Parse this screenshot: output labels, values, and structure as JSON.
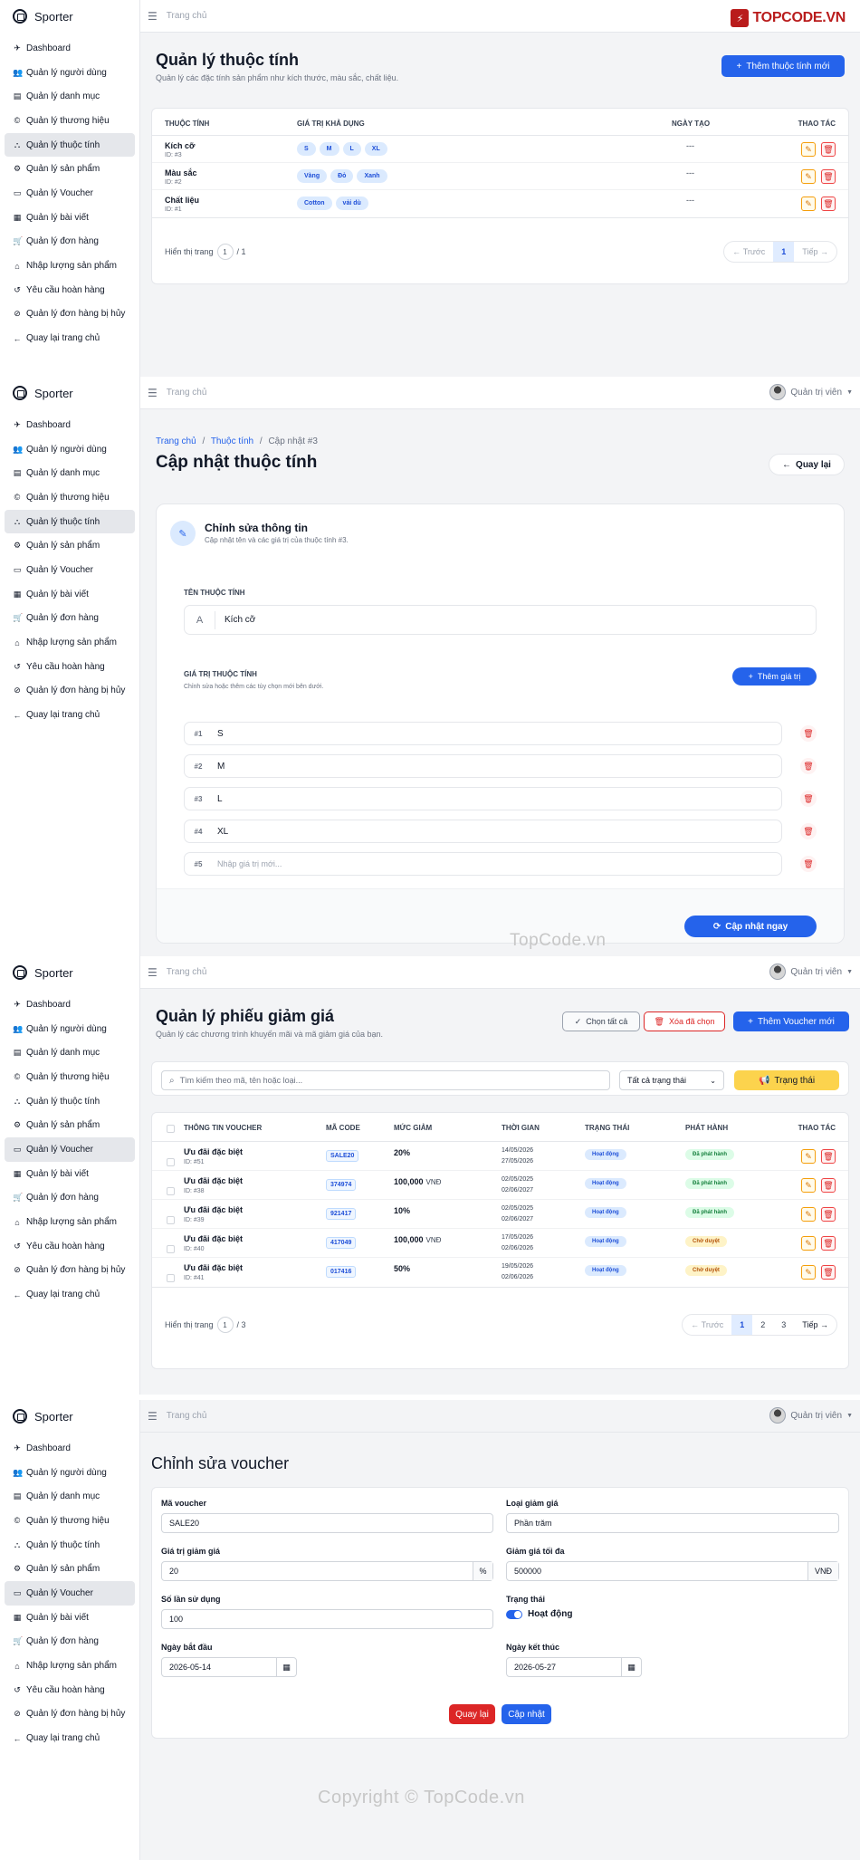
{
  "brand": "Sporter",
  "nav": [
    {
      "icon": "rocket-icon",
      "glyph": "✈",
      "label": "Dashboard"
    },
    {
      "icon": "users-icon",
      "glyph": "👥",
      "label": "Quản lý người dùng"
    },
    {
      "icon": "list-icon",
      "glyph": "▤",
      "label": "Quản lý danh mục"
    },
    {
      "icon": "copyright-icon",
      "glyph": "©",
      "label": "Quản lý thương hiệu"
    },
    {
      "icon": "sitemap-icon",
      "glyph": "⛬",
      "label": "Quản lý thuộc tính"
    },
    {
      "icon": "product-icon",
      "glyph": "⚙",
      "label": "Quản lý sản phẩm"
    },
    {
      "icon": "ticket-icon",
      "glyph": "▭",
      "label": "Quản lý Voucher"
    },
    {
      "icon": "newspaper-icon",
      "glyph": "▦",
      "label": "Quản lý bài viết"
    },
    {
      "icon": "cart-icon",
      "glyph": "🛒",
      "label": "Quản lý đơn hàng"
    },
    {
      "icon": "warehouse-icon",
      "glyph": "⌂",
      "label": "Nhập lượng sản phẩm"
    },
    {
      "icon": "undo-icon",
      "glyph": "↺",
      "label": "Yêu cầu hoàn hàng"
    },
    {
      "icon": "ban-icon",
      "glyph": "⊘",
      "label": "Quản lý đơn hàng bị hủy"
    },
    {
      "icon": "arrow-left-icon",
      "glyph": "←",
      "label": "Quay lại trang chủ"
    }
  ],
  "topbar": {
    "crumb": "Trang chủ",
    "user": "Quản trị viên"
  },
  "logo_topcode": "TOPCODE.VN",
  "attr_list": {
    "title": "Quản lý thuộc tính",
    "subtitle": "Quản lý các đặc tính sản phẩm như kích thước, màu sắc, chất liệu.",
    "add_button": "Thêm thuộc tính mới",
    "headers": [
      "THUỘC TÍNH",
      "GIÁ TRỊ KHẢ DỤNG",
      "NGÀY TẠO",
      "THAO TÁC"
    ],
    "rows": [
      {
        "name": "Kích cỡ",
        "id": "ID: #3",
        "values": [
          "S",
          "M",
          "L",
          "XL"
        ],
        "date": "---"
      },
      {
        "name": "Màu sắc",
        "id": "ID: #2",
        "values": [
          "Vàng",
          "Đỏ",
          "Xanh"
        ],
        "date": "---"
      },
      {
        "name": "Chất liệu",
        "id": "ID: #1",
        "values": [
          "Cotton",
          "vải dù"
        ],
        "date": "---"
      }
    ],
    "footer_prefix": "Hiển thị trang",
    "page": "1",
    "total": "/ 1",
    "prev": "Trước",
    "next": "Tiếp"
  },
  "attr_edit": {
    "breadcrumb": [
      "Trang chủ",
      "Thuộc tính",
      "Cập nhật #3"
    ],
    "title": "Cập nhật thuộc tính",
    "back": "Quay lại",
    "card_title": "Chỉnh sửa thông tin",
    "card_sub": "Cập nhật tên và các giá trị của thuộc tính #3.",
    "name_label": "TÊN THUỘC TÍNH",
    "name_value": "Kích cỡ",
    "values_label": "GIÁ TRỊ THUỘC TÍNH",
    "values_hint": "Chỉnh sửa hoặc thêm các tùy chọn mới bên dưới.",
    "add_value": "Thêm giá trị",
    "items": [
      {
        "num": "#1",
        "value": "S"
      },
      {
        "num": "#2",
        "value": "M"
      },
      {
        "num": "#3",
        "value": "L"
      },
      {
        "num": "#4",
        "value": "XL"
      }
    ],
    "new_num": "#5",
    "new_placeholder": "Nhập giá trị mới...",
    "submit": "Cập nhật ngay",
    "watermark": "TopCode.vn"
  },
  "voucher_list": {
    "title": "Quản lý phiếu giảm giá",
    "subtitle": "Quản lý các chương trình khuyến mãi và mã giảm giá của bạn.",
    "select_all": "Chọn tất cả",
    "delete_selected": "Xóa đã chọn",
    "add": "Thêm Voucher mới",
    "search_placeholder": "Tìm kiếm theo mã, tên hoặc loại...",
    "status_filter": "Tất cả trạng thái",
    "status_button": "Trạng thái",
    "headers": [
      "THÔNG TIN VOUCHER",
      "MÃ CODE",
      "MỨC GIẢM",
      "THỜI GIAN",
      "TRẠNG THÁI",
      "PHÁT HÀNH",
      "THAO TÁC"
    ],
    "rows": [
      {
        "name": "Ưu đãi đặc biệt",
        "id": "ID: #51",
        "code": "SALE20",
        "amount": "20%",
        "unit": "",
        "from": "14/05/2026",
        "to": "27/05/2026",
        "status": "Hoạt động",
        "publish": "Đã phát hành",
        "pub": "g"
      },
      {
        "name": "Ưu đãi đặc biệt",
        "id": "ID: #38",
        "code": "374974",
        "amount": "100,000",
        "unit": "VNĐ",
        "from": "02/05/2025",
        "to": "02/06/2027",
        "status": "Hoạt động",
        "publish": "Đã phát hành",
        "pub": "g"
      },
      {
        "name": "Ưu đãi đặc biệt",
        "id": "ID: #39",
        "code": "921417",
        "amount": "10%",
        "unit": "",
        "from": "02/05/2025",
        "to": "02/06/2027",
        "status": "Hoạt động",
        "publish": "Đã phát hành",
        "pub": "g"
      },
      {
        "name": "Ưu đãi đặc biệt",
        "id": "ID: #40",
        "code": "417049",
        "amount": "100,000",
        "unit": "VNĐ",
        "from": "17/05/2026",
        "to": "02/06/2026",
        "status": "Hoạt động",
        "publish": "Chờ duyệt",
        "pub": "y"
      },
      {
        "name": "Ưu đãi đặc biệt",
        "id": "ID: #41",
        "code": "017416",
        "amount": "50%",
        "unit": "",
        "from": "19/05/2026",
        "to": "02/06/2026",
        "status": "Hoạt động",
        "publish": "Chờ duyệt",
        "pub": "y"
      }
    ],
    "footer_prefix": "Hiển thị trang",
    "page": "1",
    "total": "/ 3",
    "prev": "Trước",
    "pages": [
      "1",
      "2",
      "3"
    ],
    "next": "Tiếp"
  },
  "voucher_edit": {
    "title": "Chỉnh sửa voucher",
    "code_label": "Mã voucher",
    "code": "SALE20",
    "type_label": "Loại giảm giá",
    "type": "Phần trăm",
    "value_label": "Giá trị giảm giá",
    "value": "20",
    "value_unit": "%",
    "max_label": "Giảm giá tối đa",
    "max": "500000",
    "max_unit": "VNĐ",
    "uses_label": "Số lần sử dụng",
    "uses": "100",
    "status_label": "Trạng thái",
    "status": "Hoạt động",
    "start_label": "Ngày bắt đầu",
    "start": "2026-05-14",
    "end_label": "Ngày kết thúc",
    "end": "2026-05-27",
    "back": "Quay lại",
    "update": "Cập nhật",
    "copyright": "Copyright © TopCode.vn"
  },
  "colors": {
    "primary": "#2563eb",
    "danger": "#dc2626",
    "warning": "#fbbf24",
    "success": "#15803d"
  }
}
